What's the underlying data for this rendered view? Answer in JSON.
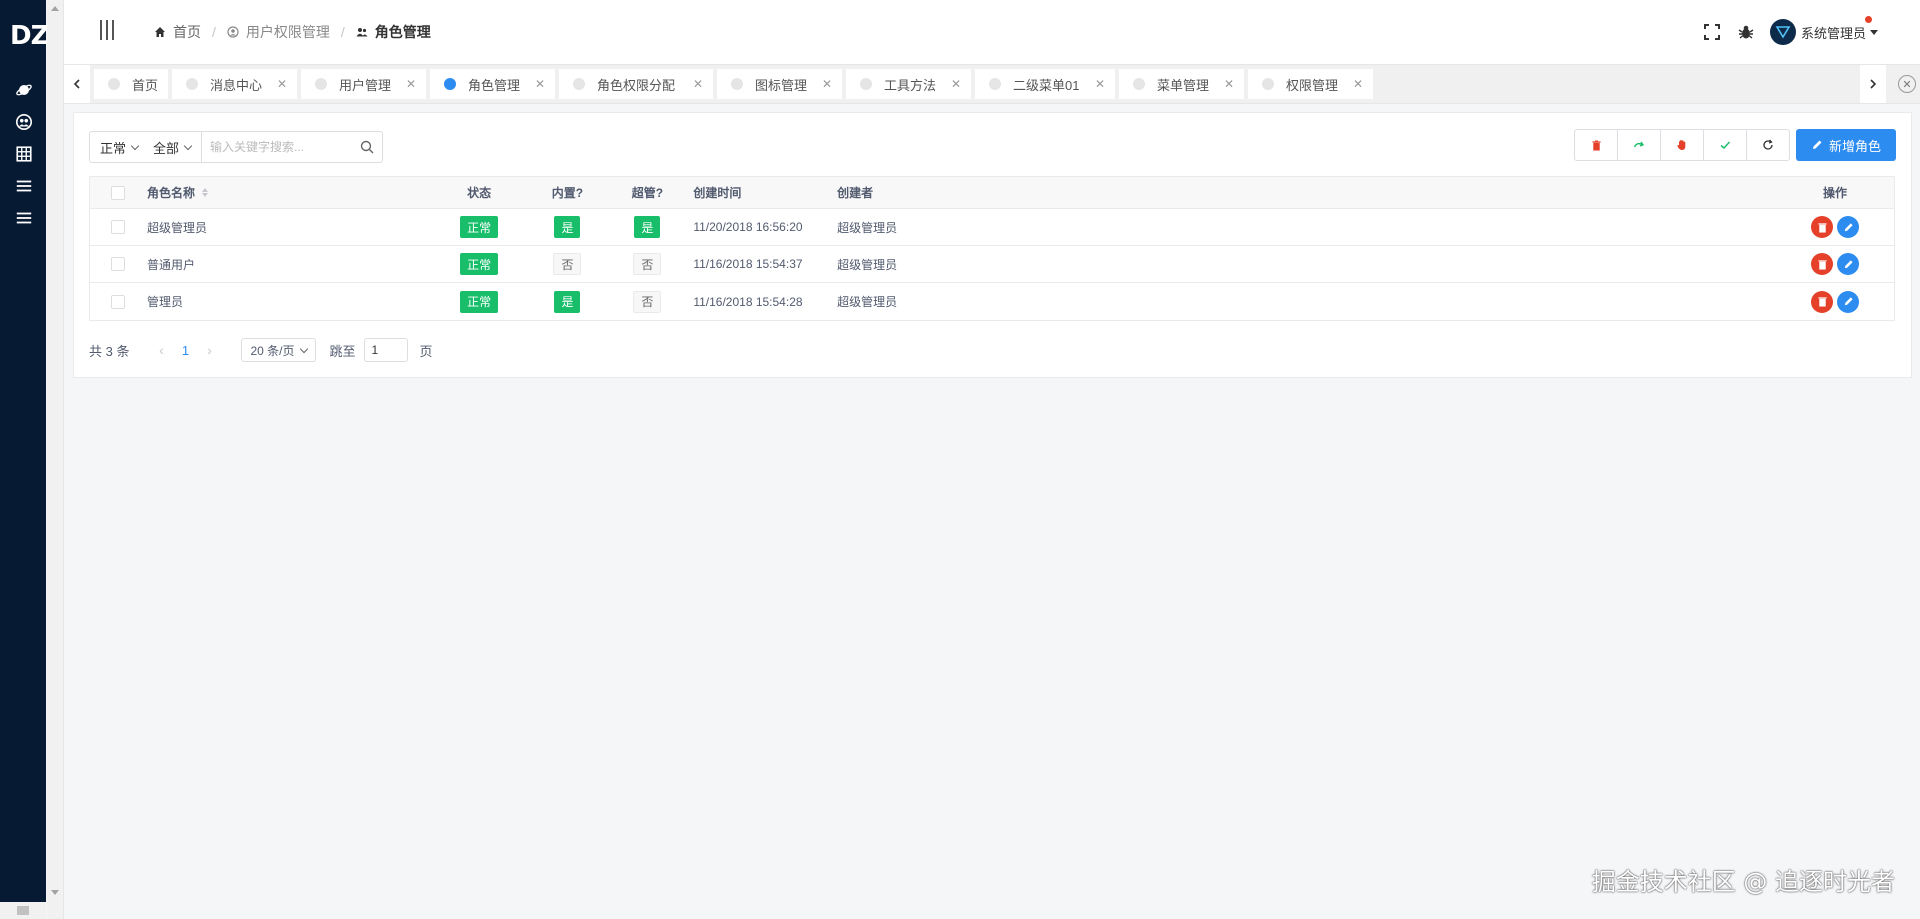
{
  "brand": {
    "logo": "DZ"
  },
  "sidebar": {
    "icons": [
      "planet-icon",
      "people-icon",
      "grid-icon",
      "menu-icon",
      "menu-alt-icon"
    ]
  },
  "header": {
    "breadcrumb": [
      {
        "label": "首页",
        "icon": "home-icon"
      },
      {
        "label": "用户权限管理",
        "icon": "user-circle-icon"
      },
      {
        "label": "角色管理",
        "icon": "people-icon"
      }
    ],
    "user_name": "系统管理员"
  },
  "tabs": [
    {
      "label": "首页",
      "closable": false,
      "active": false
    },
    {
      "label": "消息中心",
      "closable": true,
      "active": false
    },
    {
      "label": "用户管理",
      "closable": true,
      "active": false
    },
    {
      "label": "角色管理",
      "closable": true,
      "active": true
    },
    {
      "label": "角色权限分配",
      "closable": true,
      "active": false
    },
    {
      "label": "图标管理",
      "closable": true,
      "active": false
    },
    {
      "label": "工具方法",
      "closable": true,
      "active": false
    },
    {
      "label": "二级菜单01",
      "closable": true,
      "active": false
    },
    {
      "label": "菜单管理",
      "closable": true,
      "active": false
    },
    {
      "label": "权限管理",
      "closable": true,
      "active": false
    }
  ],
  "filter": {
    "status": "正常",
    "scope": "全部",
    "search_placeholder": "输入关键字搜索...",
    "search_value": ""
  },
  "toolbar": {
    "add_label": "新增角色"
  },
  "table": {
    "headers": {
      "name": "角色名称",
      "status": "状态",
      "builtin": "内置?",
      "super": "超管?",
      "created_at": "创建时间",
      "creator": "创建者",
      "ops": "操作"
    },
    "rows": [
      {
        "name": "超级管理员",
        "status": "正常",
        "builtin": "是",
        "super": "是",
        "created_at": "11/20/2018 16:56:20",
        "creator": "超级管理员"
      },
      {
        "name": "普通用户",
        "status": "正常",
        "builtin": "否",
        "super": "否",
        "created_at": "11/16/2018 15:54:37",
        "creator": "超级管理员"
      },
      {
        "name": "管理员",
        "status": "正常",
        "builtin": "是",
        "super": "否",
        "created_at": "11/16/2018 15:54:28",
        "creator": "超级管理员"
      }
    ]
  },
  "pagination": {
    "total": "共 3 条",
    "current_page": "1",
    "page_size": "20 条/页",
    "jump_label": "跳至",
    "jump_value": "1",
    "unit": "页"
  },
  "watermark": "掘金技术社区 @ 追逐时光者",
  "colors": {
    "sidebar": "#071a33",
    "primary": "#2d8cf0",
    "success": "#19be6b",
    "danger": "#e5402a"
  }
}
